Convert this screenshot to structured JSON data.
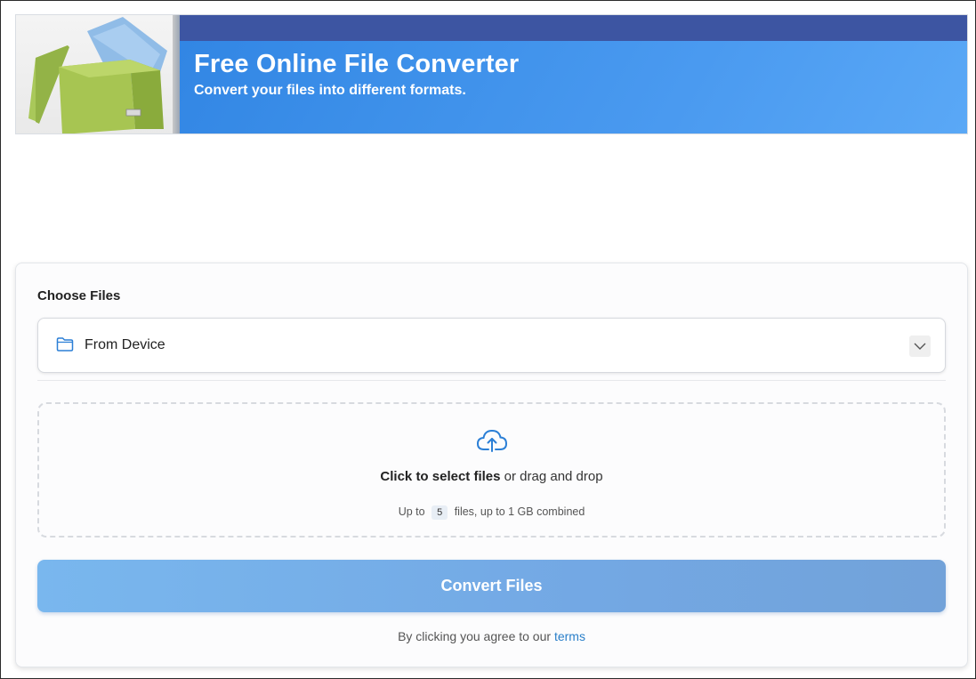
{
  "banner": {
    "title": "Free Online File Converter",
    "subtitle": "Convert your files into different formats."
  },
  "upload": {
    "choose_label": "Choose Files",
    "source_selected": "From Device",
    "drop_text_bold": "Click to select files",
    "drop_text_rest": " or drag and drop",
    "limit_prefix": "Up to",
    "limit_count": "5",
    "limit_suffix": "files, up to 1 GB combined"
  },
  "actions": {
    "convert_label": "Convert Files"
  },
  "terms": {
    "prefix": "By clicking you agree to our ",
    "link_label": "terms"
  },
  "colors": {
    "banner_blue": "#3c8fe9",
    "banner_top": "#3d55a2",
    "button_blue": "#79b7ee",
    "link_blue": "#2a7fc9",
    "icon_blue": "#2b7fd6"
  },
  "icons": {
    "folder": "folder-icon",
    "chevron": "chevron-down-icon",
    "upload": "cloud-upload-icon"
  }
}
